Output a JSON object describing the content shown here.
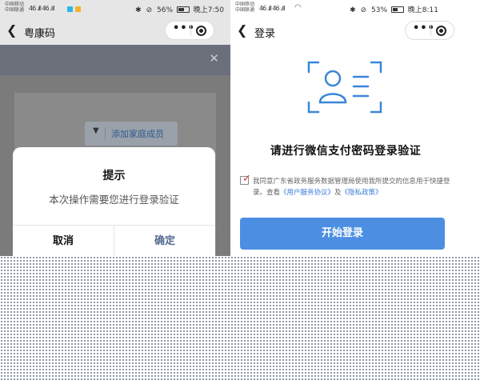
{
  "left": {
    "status": {
      "carrier_1": "中国移动",
      "carrier_2": "中国联通",
      "signal": "46 .ıll 46 .ıll",
      "battery": "56%",
      "time": "晚上7:50",
      "battery_level": 0.56
    },
    "nav": {
      "back_icon": "chevron-left-icon",
      "title": "粤康码",
      "more": "•••"
    },
    "family_button": {
      "arrow": "▼",
      "label": "添加家庭成员"
    },
    "dialog": {
      "title": "提示",
      "message": "本次操作需要您进行登录验证",
      "cancel_label": "取消",
      "confirm_label": "确定"
    },
    "colors": {
      "confirm": "#55698f"
    }
  },
  "right": {
    "status": {
      "carrier_1": "中国移动",
      "carrier_2": "中国联通",
      "signal": "46 .ıll 46 .ıll",
      "battery": "53%",
      "time": "晚上8:11",
      "battery_level": 0.53
    },
    "nav": {
      "back_icon": "chevron-left-icon",
      "title": "登录",
      "more": "•••"
    },
    "heading": "请进行微信支付密码登录验证",
    "consent": {
      "prefix": "我同意广东省政务服务数据管理局使用我所提交的信息用于快捷登录。查看",
      "link1": "《用户服务协议》",
      "middle": "及",
      "link2": "《隐私政策》"
    },
    "start_button_label": "开始登录",
    "colors": {
      "accent": "#4c8fe2",
      "icon": "#3a86d8"
    }
  }
}
